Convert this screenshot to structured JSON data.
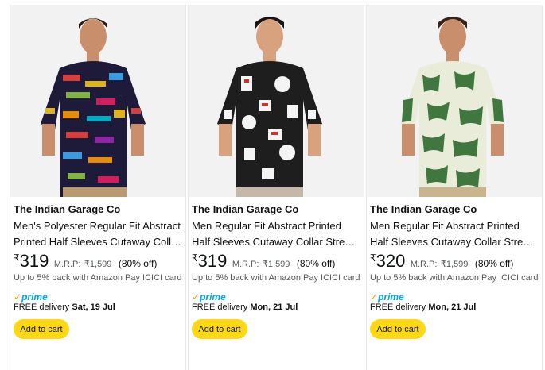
{
  "products": [
    {
      "brand": "The Indian Garage Co",
      "title": "Men's Polyester Regular Fit Abstract Printed Half Sleeves Cutaway Collar Shirt",
      "currency": "₹",
      "price": "319",
      "mrp_label": "M.R.P:",
      "mrp": "₹1,599",
      "discount": "(80% off)",
      "cashback": "Up to 5% back with Amazon Pay ICICI card",
      "prime": "prime",
      "delivery_prefix": "FREE delivery",
      "delivery_date": "Sat, 19 Jul",
      "cta": "Add to cart"
    },
    {
      "brand": "The Indian Garage Co",
      "title": "Men Regular Fit Abstract Printed Half Sleeves Cutaway Collar Street Wear Shirt",
      "currency": "₹",
      "price": "319",
      "mrp_label": "M.R.P:",
      "mrp": "₹1,599",
      "discount": "(80% off)",
      "cashback": "Up to 5% back with Amazon Pay ICICI card",
      "prime": "prime",
      "delivery_prefix": "FREE delivery",
      "delivery_date": "Mon, 21 Jul",
      "cta": "Add to cart"
    },
    {
      "brand": "The Indian Garage Co",
      "title": "Men Regular Fit Abstract Printed Half Sleeves Cutaway Collar Street Wear Shirt",
      "currency": "₹",
      "price": "320",
      "mrp_label": "M.R.P:",
      "mrp": "₹1,599",
      "discount": "(80% off)",
      "cashback": "Up to 5% back with Amazon Pay ICICI card",
      "prime": "prime",
      "delivery_prefix": "FREE delivery",
      "delivery_date": "Mon, 21 Jul",
      "cta": "Add to cart"
    }
  ],
  "colors": {
    "cta_background": "#FFD814",
    "prime_blue": "#00a8e1",
    "prime_check": "#ff9900",
    "muted_text": "#565959"
  }
}
